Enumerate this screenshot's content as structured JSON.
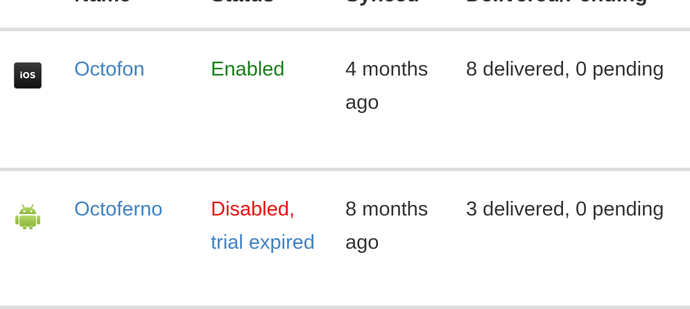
{
  "colors": {
    "link": "#4183c4",
    "enabled": "#1a7f1a",
    "disabled": "#ee1111",
    "text": "#333333",
    "divider": "#dddddd"
  },
  "table": {
    "headers": {
      "name": "Name",
      "status": "Status",
      "synced": "Synced",
      "delivered": "Delivered/Pending"
    },
    "rows": [
      {
        "platform_icon": "ios-icon",
        "icon_text": "iOS",
        "name": "Octofon",
        "status": "Enabled",
        "status_type": "enabled",
        "synced": "4 months ago",
        "delivered": "8 delivered, 0 pending"
      },
      {
        "platform_icon": "android-icon",
        "name": "Octoferno",
        "status": "Disabled,",
        "status_link": "trial expired",
        "status_type": "disabled",
        "synced": "8 months ago",
        "delivered": "3 delivered, 0 pending"
      }
    ]
  }
}
